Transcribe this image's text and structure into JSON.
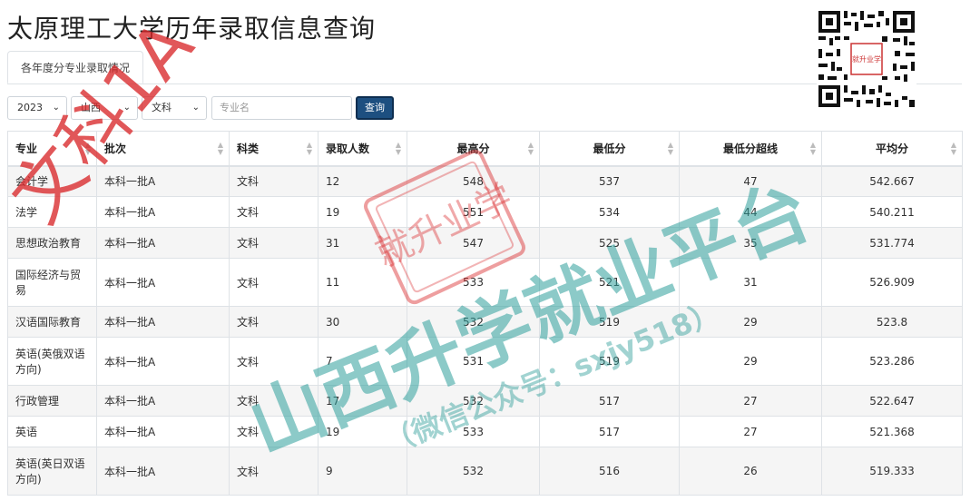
{
  "page": {
    "title": "太原理工大学历年录取信息查询"
  },
  "tabs": [
    {
      "label": "各年度分专业录取情况"
    }
  ],
  "filters": {
    "year": "2023",
    "province": "山西",
    "category": "文科",
    "major_placeholder": "专业名",
    "query_label": "查询"
  },
  "qr": {
    "stamp_text": "就升业学"
  },
  "table": {
    "headers": [
      "专业",
      "批次",
      "科类",
      "录取人数",
      "最高分",
      "最低分",
      "最低分超线",
      "平均分"
    ],
    "rows": [
      [
        "会计学",
        "本科一批A",
        "文科",
        "12",
        "548",
        "537",
        "47",
        "542.667"
      ],
      [
        "法学",
        "本科一批A",
        "文科",
        "19",
        "551",
        "534",
        "44",
        "540.211"
      ],
      [
        "思想政治教育",
        "本科一批A",
        "文科",
        "31",
        "547",
        "525",
        "35",
        "531.774"
      ],
      [
        "国际经济与贸易",
        "本科一批A",
        "文科",
        "11",
        "533",
        "521",
        "31",
        "526.909"
      ],
      [
        "汉语国际教育",
        "本科一批A",
        "文科",
        "30",
        "532",
        "519",
        "29",
        "523.8"
      ],
      [
        "英语(英俄双语方向)",
        "本科一批A",
        "文科",
        "7",
        "531",
        "519",
        "29",
        "523.286"
      ],
      [
        "行政管理",
        "本科一批A",
        "文科",
        "17",
        "532",
        "517",
        "27",
        "522.647"
      ],
      [
        "英语",
        "本科一批A",
        "文科",
        "19",
        "533",
        "517",
        "27",
        "521.368"
      ],
      [
        "英语(英日双语方向)",
        "本科一批A",
        "文科",
        "9",
        "532",
        "516",
        "26",
        "519.333"
      ]
    ]
  },
  "watermarks": {
    "diagonal": "文科1A",
    "stamp": "就升业学",
    "platform": "山西升学就业平台",
    "wechat": "（微信公众号：sxjy518）"
  },
  "colors": {
    "button": "#1d4f80",
    "watermark_red": "#d9282a",
    "watermark_teal": "#2e9e9a"
  }
}
